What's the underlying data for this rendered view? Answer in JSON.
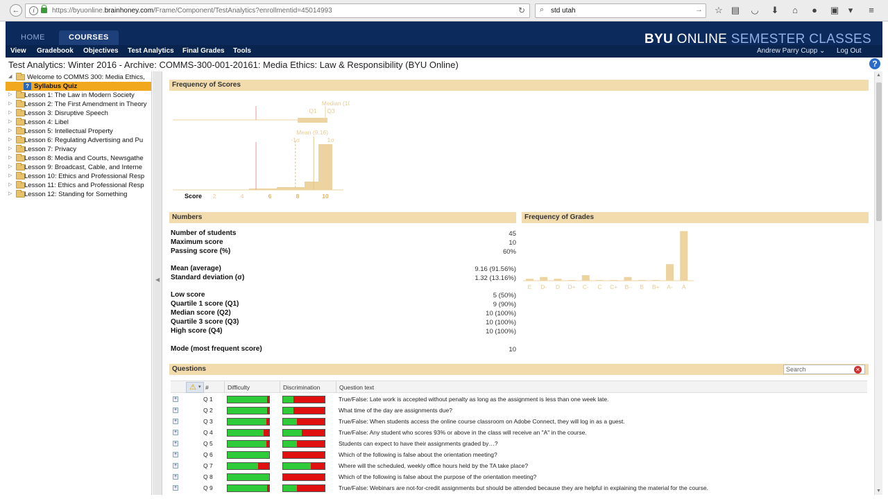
{
  "browser": {
    "url_prefix": "https://byuonline.",
    "url_domain": "brainhoney.com",
    "url_path": "/Frame/Component/TestAnalytics?enrollmentid=45014993",
    "search_query": "std utah"
  },
  "header": {
    "tabs": [
      "HOME",
      "COURSES"
    ],
    "brand_bold": "BYU",
    "brand_online": "ONLINE",
    "brand_rest": "SEMESTER CLASSES",
    "menu": [
      "View",
      "Gradebook",
      "Objectives",
      "Test Analytics",
      "Final Grades",
      "Tools"
    ],
    "user": "Andrew Parry Cupp",
    "logout": "Log Out"
  },
  "page_title": "Test Analytics: Winter 2016 - Archive: COMMS-300-001-20161: Media Ethics: Law & Responsibility (BYU Online)",
  "sidebar": {
    "root": "Welcome to COMMS 300: Media Ethics, ",
    "selected": "Syllabus Quiz",
    "lessons": [
      "Lesson 1: The Law in Modern Society",
      "Lesson 2: The First Amendment in Theory",
      "Lesson 3: Disruptive Speech",
      "Lesson 4: Libel",
      "Lesson 5: Intellectual Property",
      "Lesson 6: Regulating Advertising and Pu",
      "Lesson 7: Privacy",
      "Lesson 8: Media and Courts, Newsgathe",
      "Lesson 9: Broadcast, Cable, and Interne",
      "Lesson 10: Ethics and Professional Resp",
      "Lesson 11: Ethics and Professional Resp",
      "Lesson 12: Standing for Something"
    ]
  },
  "sections": {
    "frequency_scores": "Frequency of Scores",
    "numbers": "Numbers",
    "frequency_grades": "Frequency of Grades",
    "questions": "Questions"
  },
  "numbers": [
    {
      "label": "Number of students",
      "value": "45"
    },
    {
      "label": "Maximum score",
      "value": "10"
    },
    {
      "label": "Passing score (%)",
      "value": "60%"
    },
    {
      "label": "Mean (average)",
      "value": "9.16 (91.56%)"
    },
    {
      "label": "Standard deviation (σ)",
      "value": "1.32 (13.16%)"
    },
    {
      "label": "Low score",
      "value": "5 (50%)"
    },
    {
      "label": "Quartile 1 score (Q1)",
      "value": "9 (90%)"
    },
    {
      "label": "Median score (Q2)",
      "value": "10 (100%)"
    },
    {
      "label": "Quartile 3 score (Q3)",
      "value": "10 (100%)"
    },
    {
      "label": "High score (Q4)",
      "value": "10 (100%)"
    },
    {
      "label": "Mode (most frequent score)",
      "value": "10"
    }
  ],
  "score_chart": {
    "median_label": "Median (10",
    "q1_label": "Q1",
    "q3_label": "Q3",
    "mean_label": "Mean (9.16)",
    "minus_sigma": "-1σ",
    "plus_sigma": "1σ",
    "axis_title": "Score",
    "ticks": [
      "2",
      "4",
      "6",
      "8",
      "10"
    ]
  },
  "chart_data": [
    {
      "type": "bar",
      "title": "Frequency of Scores",
      "xlabel": "Score",
      "categories": [
        "5",
        "6",
        "7",
        "8",
        "9",
        "10"
      ],
      "values": [
        1,
        1,
        2,
        2,
        6,
        33
      ],
      "markers": {
        "mean": 9.16,
        "minus_sigma": 7.84,
        "plus_sigma": 10.48,
        "q1": 9,
        "median": 10,
        "q3": 10,
        "low": 5,
        "high": 10
      },
      "xlim": [
        1,
        11
      ]
    },
    {
      "type": "bar",
      "title": "Frequency of Grades",
      "categories": [
        "E",
        "D-",
        "D",
        "D+",
        "C-",
        "C",
        "C+",
        "B-",
        "B",
        "B+",
        "A-",
        "A"
      ],
      "values": [
        1,
        2,
        1,
        0,
        3,
        0,
        0,
        2,
        0,
        0,
        9,
        27
      ]
    }
  ],
  "questions": {
    "search_placeholder": "Search",
    "headers": {
      "num": "#",
      "difficulty": "Difficulty",
      "discrimination": "Discrimination",
      "text": "Question text"
    },
    "rows": [
      {
        "num": "Q 1",
        "difficulty": 0.95,
        "discrimination": 0.25,
        "text": "True/False: Late work is accepted without penalty as long as the assignment is less than one week late."
      },
      {
        "num": "Q 2",
        "difficulty": 0.95,
        "discrimination": 0.25,
        "text": "What time of the day are assignments due?"
      },
      {
        "num": "Q 3",
        "difficulty": 0.93,
        "discrimination": 0.33,
        "text": "True/False: When students access the online course classroom on Adobe Connect, they will log in as a guest."
      },
      {
        "num": "Q 4",
        "difficulty": 0.87,
        "discrimination": 0.45,
        "text": "True/False: Any student who scores 93% or above in the class will receive an \"A\" in the course."
      },
      {
        "num": "Q 5",
        "difficulty": 0.93,
        "discrimination": 0.33,
        "text": "Students can expect to have their assignments graded by…?"
      },
      {
        "num": "Q 6",
        "difficulty": 1.0,
        "discrimination": 0.0,
        "text": "Which of the following is false about the orientation meeting?"
      },
      {
        "num": "Q 7",
        "difficulty": 0.73,
        "discrimination": 0.66,
        "text": "Where will the scheduled, weekly office hours held by the TA take place?"
      },
      {
        "num": "Q 8",
        "difficulty": 1.0,
        "discrimination": 0.0,
        "text": "Which of the following is false about the purpose of the orientation meeting?"
      },
      {
        "num": "Q 9",
        "difficulty": 0.95,
        "discrimination": 0.33,
        "text": "True/False: Webinars are not-for-credit assignments but should be attended because they are helpful in explaining the material for the course."
      }
    ]
  }
}
